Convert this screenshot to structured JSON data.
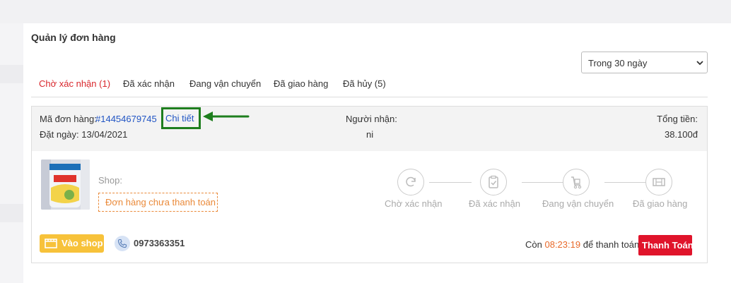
{
  "page": {
    "title": "Quản lý đơn hàng"
  },
  "filter": {
    "period": "Trong 30 ngày"
  },
  "tabs": [
    {
      "label": "Chờ xác nhận (1)",
      "active": true
    },
    {
      "label": "Đã xác nhận",
      "active": false
    },
    {
      "label": "Đang vận chuyển",
      "active": false
    },
    {
      "label": "Đã giao hàng",
      "active": false
    },
    {
      "label": "Đã hủy (5)",
      "active": false
    }
  ],
  "order": {
    "code_label": "Mã đơn hàng:",
    "code": "#14454679745",
    "detail_link": "Chi tiết",
    "date_label": "Đặt ngày: 13/04/2021",
    "recipient_label": "Người nhận:",
    "recipient": "ni",
    "total_label": "Tổng tiền:",
    "total": "38.100đ",
    "shop_label": "Shop:",
    "payment_status": "Đơn hàng chưa thanh toán",
    "steps": [
      {
        "label": "Chờ xác nhận",
        "icon": "refresh-icon"
      },
      {
        "label": "Đã xác nhận",
        "icon": "clipboard-check-icon"
      },
      {
        "label": "Đang vận chuyển",
        "icon": "trolley-icon"
      },
      {
        "label": "Đã giao hàng",
        "icon": "delivered-box-icon"
      }
    ],
    "shop_button": "Vào shop",
    "phone": "0973363351",
    "pay_prefix": "Còn",
    "countdown": "08:23:19",
    "pay_suffix": "để thanh toán",
    "pay_button": "Thanh Toán"
  },
  "colors": {
    "active_tab": "#d9262c",
    "link": "#2155c4",
    "highlight_border": "#1e7e1e",
    "unpaid": "#ea8a3a",
    "shop_button": "#f7c23a",
    "pay_button": "#e0142b",
    "countdown": "#e8692a"
  }
}
